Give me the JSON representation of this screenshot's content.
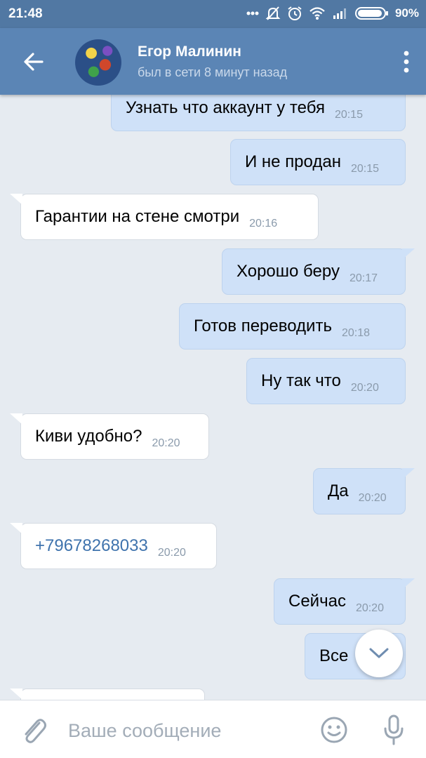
{
  "status_bar": {
    "time": "21:48",
    "battery": "90%",
    "icons": [
      "dots-icon",
      "muted-bell-icon",
      "alarm-icon",
      "wifi-icon",
      "signal-icon",
      "battery-icon"
    ]
  },
  "header": {
    "back_icon": "arrow-left-icon",
    "name": "Егор Малинин",
    "status": "был в сети 8 минут назад",
    "menu_icon": "more-vertical-icon"
  },
  "messages": [
    {
      "dir": "out",
      "text": "Узнать что аккаунт у тебя",
      "time": "20:15"
    },
    {
      "dir": "out",
      "text": "И не продан",
      "time": "20:15"
    },
    {
      "dir": "in",
      "text": "Гарантии на стене смотри",
      "time": "20:16"
    },
    {
      "dir": "out",
      "text": "Хорошо беру",
      "time": "20:17"
    },
    {
      "dir": "out",
      "text": "Готов переводить",
      "time": "20:18"
    },
    {
      "dir": "out",
      "text": "Ну так что",
      "time": "20:20"
    },
    {
      "dir": "in",
      "text": "Киви удобно?",
      "time": "20:20"
    },
    {
      "dir": "out",
      "text": "Да",
      "time": "20:20"
    },
    {
      "dir": "in",
      "text": "+79678268033",
      "time": "20:20",
      "link": true
    },
    {
      "dir": "out",
      "text": "Сейчас",
      "time": "20:20"
    },
    {
      "dir": "out",
      "text": "Все",
      "time": ""
    }
  ],
  "composer": {
    "placeholder": "Ваше сообщение",
    "attach_icon": "paperclip-icon",
    "emoji_icon": "smiley-icon",
    "mic_icon": "microphone-icon"
  },
  "colors": {
    "header": "#5b85b5",
    "status_bar": "#5178a3",
    "outgoing_bubble": "#cfe1f8",
    "incoming_bubble": "#ffffff",
    "chat_bg": "#e6ebf1",
    "link": "#3f73ad"
  }
}
